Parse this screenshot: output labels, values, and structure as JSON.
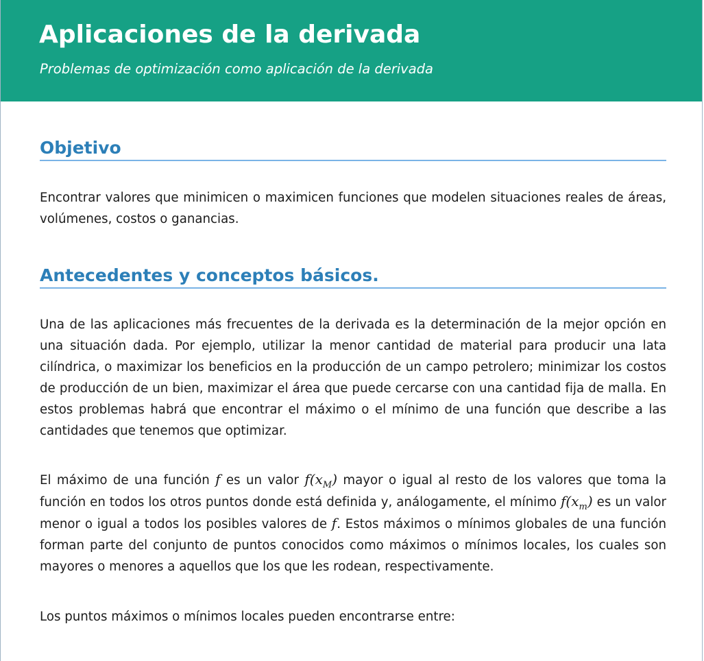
{
  "header": {
    "title": "Aplicaciones de la derivada",
    "subtitle": "Problemas de optimización como aplicación de la derivada"
  },
  "sections": [
    {
      "heading": "Objetivo",
      "paragraph": "Encontrar valores que minimicen o maximicen funciones que modelen situaciones reales de áreas, volúmenes, costos o ganancias."
    },
    {
      "heading": "Antecedentes y conceptos básicos.",
      "paragraph1": "Una de las aplicaciones más frecuentes de la derivada es la determinación de la mejor opción en una situación dada. Por ejemplo, utilizar la menor cantidad de material para producir una lata cilíndrica, o maximizar los beneficios en la producción de un campo petrolero; minimizar los costos de producción de un bien, maximizar el área que puede cercarse con una cantidad fija de malla. En estos problemas habrá que encontrar el máximo o el mínimo de una función que describe a las cantidades que tenemos que optimizar.",
      "paragraph2": {
        "t1": "El máximo de una función ",
        "m1": "f",
        "t2": " es un valor ",
        "m2_base": "f(x",
        "m2_sub": "M",
        "m2_close": ")",
        "t3": " mayor o igual al resto de los valores que toma la función en todos los otros puntos donde está definida y, análogamente, el mínimo ",
        "m3_base": "f(x",
        "m3_sub": "m",
        "m3_close": ")",
        "t4": " es un valor menor o igual a todos los posibles valores de ",
        "m4": "f",
        "t5": ". Estos máximos o mínimos globales de una función forman parte del conjunto de puntos conocidos como máximos o mínimos locales, los cuales son mayores o menores a aquellos que los que les rodean, respectivamente."
      },
      "paragraph3": "Los puntos máximos o mínimos locales pueden encontrarse entre:"
    }
  ]
}
